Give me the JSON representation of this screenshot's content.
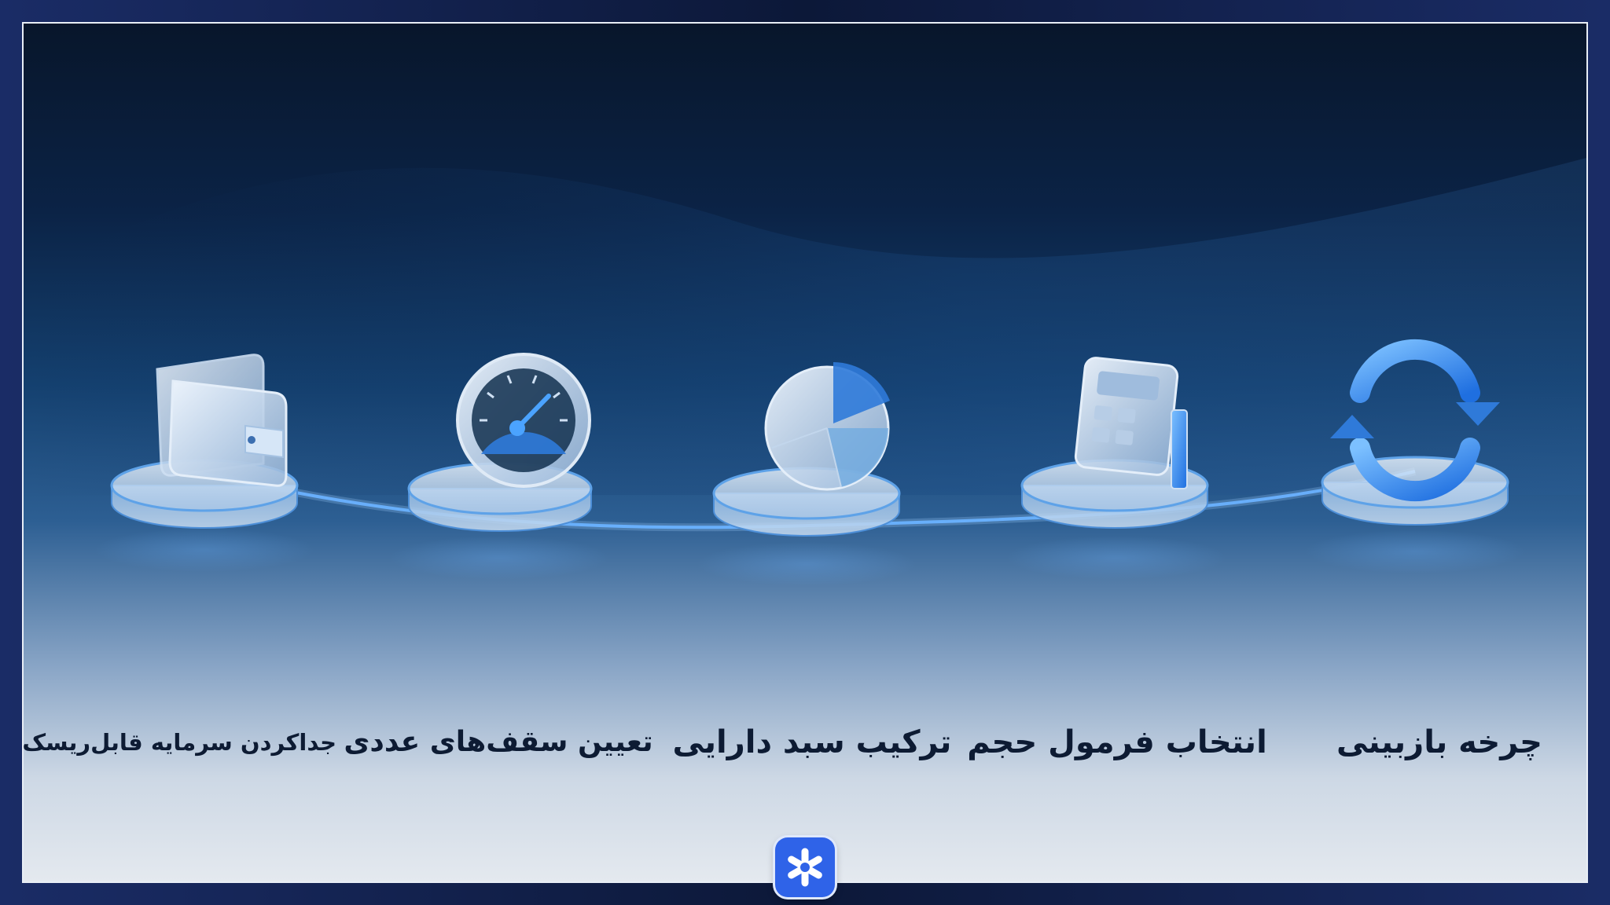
{
  "steps": [
    {
      "id": "revision-cycle",
      "label": "چرخه بازبینی",
      "icon": "refresh-cycle-icon"
    },
    {
      "id": "volume-formula",
      "label": "انتخاب فرمول حجم",
      "icon": "calculator-icon"
    },
    {
      "id": "asset-basket",
      "label": "ترکیب سبد دارایی",
      "icon": "pie-chart-icon"
    },
    {
      "id": "numeric-caps",
      "label": "تعیین سقف‌های عددی",
      "icon": "speedometer-icon"
    },
    {
      "id": "risk-capital",
      "label": "جداکردن سرمایه قابل‌ریسک",
      "icon": "wallet-icon"
    }
  ],
  "logo": {
    "icon": "asterisk-logo-icon",
    "color": "#2f63e8"
  },
  "colors": {
    "accent": "#2f7fff",
    "glass": "#cfe3f7",
    "text": "#0d1b33"
  }
}
